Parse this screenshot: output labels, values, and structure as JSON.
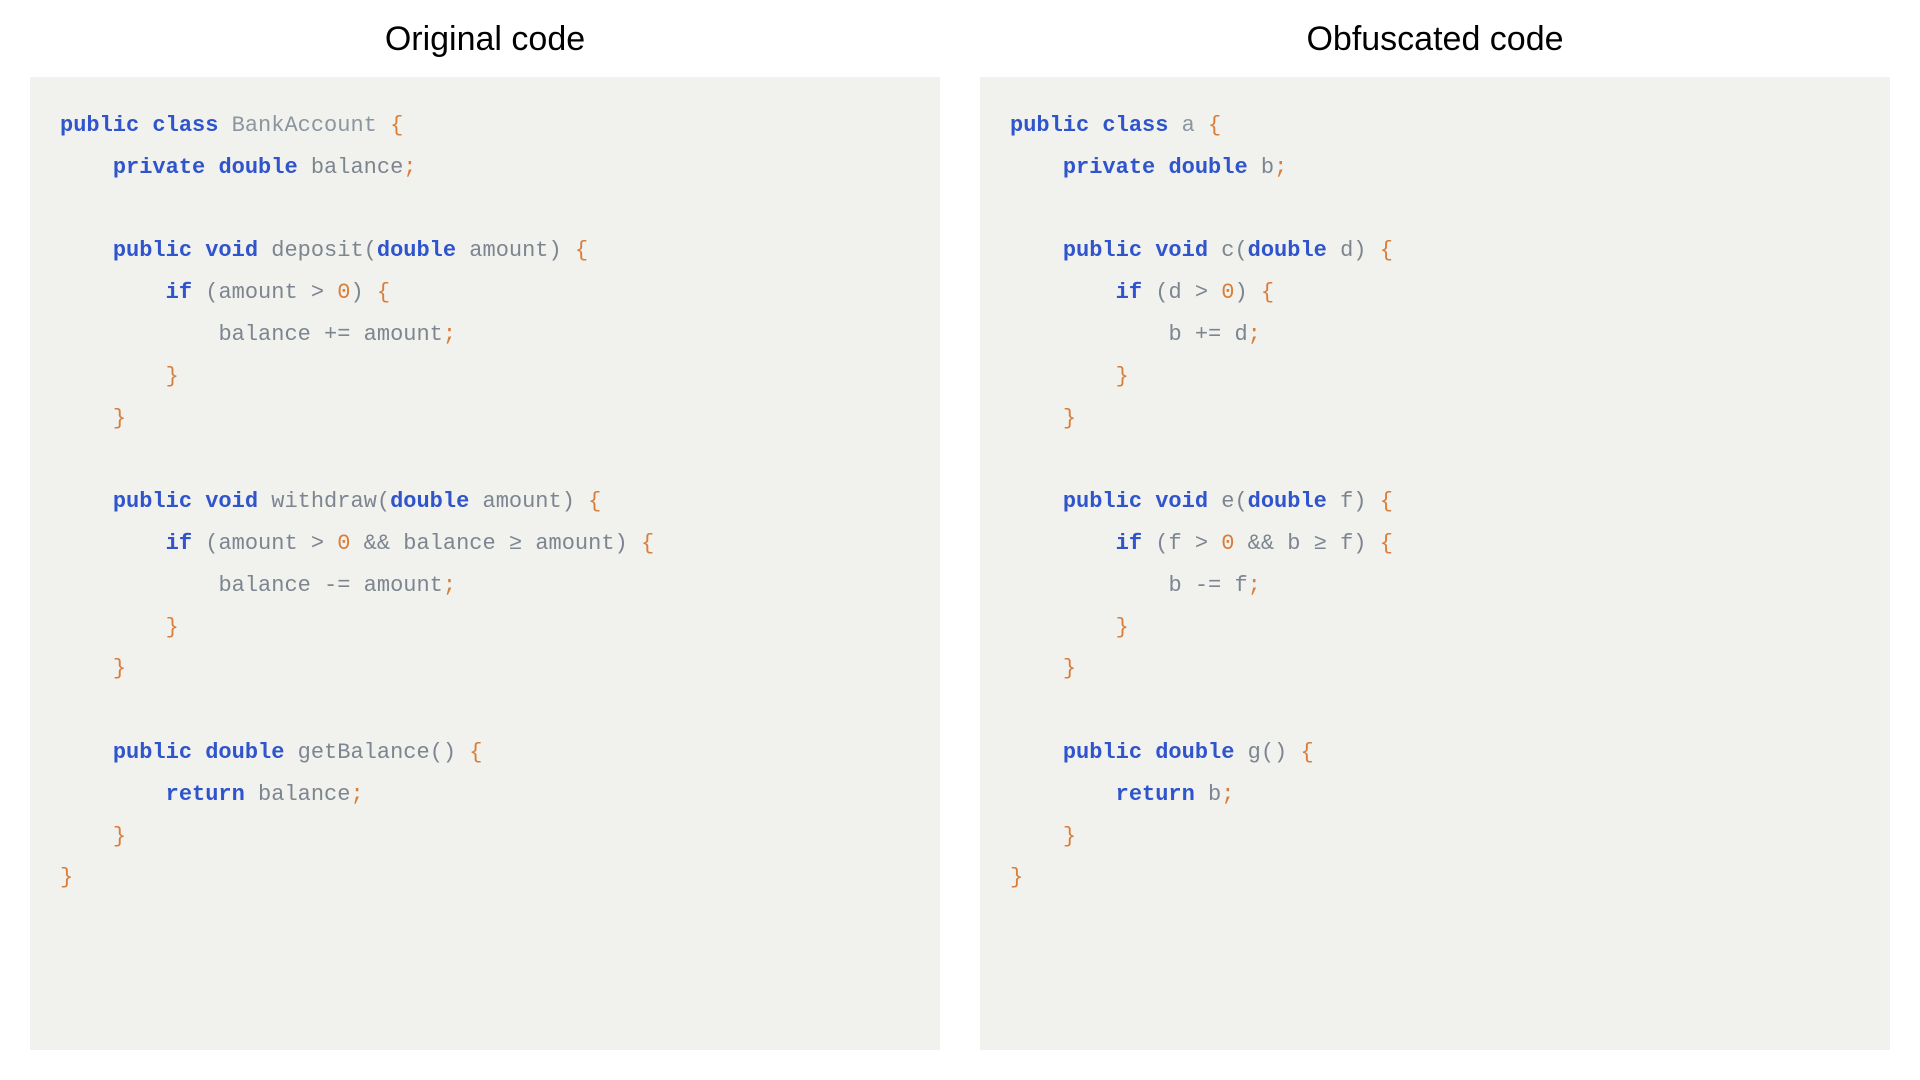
{
  "left": {
    "title": "Original code",
    "code": [
      [
        {
          "t": "public",
          "c": "kw"
        },
        {
          "t": " ",
          "c": ""
        },
        {
          "t": "class",
          "c": "kw"
        },
        {
          "t": " ",
          "c": ""
        },
        {
          "t": "BankAccount",
          "c": "cls"
        },
        {
          "t": " ",
          "c": ""
        },
        {
          "t": "{",
          "c": "pun"
        }
      ],
      [
        {
          "t": "    ",
          "c": ""
        },
        {
          "t": "private",
          "c": "kw"
        },
        {
          "t": " ",
          "c": ""
        },
        {
          "t": "double",
          "c": "typ"
        },
        {
          "t": " ",
          "c": ""
        },
        {
          "t": "balance",
          "c": "id"
        },
        {
          "t": ";",
          "c": "pun"
        }
      ],
      [],
      [
        {
          "t": "    ",
          "c": ""
        },
        {
          "t": "public",
          "c": "kw"
        },
        {
          "t": " ",
          "c": ""
        },
        {
          "t": "void",
          "c": "kw"
        },
        {
          "t": " ",
          "c": ""
        },
        {
          "t": "deposit",
          "c": "fn"
        },
        {
          "t": "(",
          "c": "op"
        },
        {
          "t": "double",
          "c": "typ"
        },
        {
          "t": " ",
          "c": ""
        },
        {
          "t": "amount",
          "c": "id"
        },
        {
          "t": ")",
          "c": "op"
        },
        {
          "t": " ",
          "c": ""
        },
        {
          "t": "{",
          "c": "pun"
        }
      ],
      [
        {
          "t": "        ",
          "c": ""
        },
        {
          "t": "if",
          "c": "kw"
        },
        {
          "t": " ",
          "c": ""
        },
        {
          "t": "(",
          "c": "op"
        },
        {
          "t": "amount",
          "c": "id"
        },
        {
          "t": " > ",
          "c": "op"
        },
        {
          "t": "0",
          "c": "num"
        },
        {
          "t": ")",
          "c": "op"
        },
        {
          "t": " ",
          "c": ""
        },
        {
          "t": "{",
          "c": "pun"
        }
      ],
      [
        {
          "t": "            ",
          "c": ""
        },
        {
          "t": "balance",
          "c": "id"
        },
        {
          "t": " += ",
          "c": "op"
        },
        {
          "t": "amount",
          "c": "id"
        },
        {
          "t": ";",
          "c": "pun"
        }
      ],
      [
        {
          "t": "        ",
          "c": ""
        },
        {
          "t": "}",
          "c": "pun"
        }
      ],
      [
        {
          "t": "    ",
          "c": ""
        },
        {
          "t": "}",
          "c": "pun"
        }
      ],
      [],
      [
        {
          "t": "    ",
          "c": ""
        },
        {
          "t": "public",
          "c": "kw"
        },
        {
          "t": " ",
          "c": ""
        },
        {
          "t": "void",
          "c": "kw"
        },
        {
          "t": " ",
          "c": ""
        },
        {
          "t": "withdraw",
          "c": "fn"
        },
        {
          "t": "(",
          "c": "op"
        },
        {
          "t": "double",
          "c": "typ"
        },
        {
          "t": " ",
          "c": ""
        },
        {
          "t": "amount",
          "c": "id"
        },
        {
          "t": ")",
          "c": "op"
        },
        {
          "t": " ",
          "c": ""
        },
        {
          "t": "{",
          "c": "pun"
        }
      ],
      [
        {
          "t": "        ",
          "c": ""
        },
        {
          "t": "if",
          "c": "kw"
        },
        {
          "t": " ",
          "c": ""
        },
        {
          "t": "(",
          "c": "op"
        },
        {
          "t": "amount",
          "c": "id"
        },
        {
          "t": " > ",
          "c": "op"
        },
        {
          "t": "0",
          "c": "num"
        },
        {
          "t": " && ",
          "c": "op"
        },
        {
          "t": "balance",
          "c": "id"
        },
        {
          "t": " ≥ ",
          "c": "op"
        },
        {
          "t": "amount",
          "c": "id"
        },
        {
          "t": ")",
          "c": "op"
        },
        {
          "t": " ",
          "c": ""
        },
        {
          "t": "{",
          "c": "pun"
        }
      ],
      [
        {
          "t": "            ",
          "c": ""
        },
        {
          "t": "balance",
          "c": "id"
        },
        {
          "t": " -= ",
          "c": "op"
        },
        {
          "t": "amount",
          "c": "id"
        },
        {
          "t": ";",
          "c": "pun"
        }
      ],
      [
        {
          "t": "        ",
          "c": ""
        },
        {
          "t": "}",
          "c": "pun"
        }
      ],
      [
        {
          "t": "    ",
          "c": ""
        },
        {
          "t": "}",
          "c": "pun"
        }
      ],
      [],
      [
        {
          "t": "    ",
          "c": ""
        },
        {
          "t": "public",
          "c": "kw"
        },
        {
          "t": " ",
          "c": ""
        },
        {
          "t": "double",
          "c": "typ"
        },
        {
          "t": " ",
          "c": ""
        },
        {
          "t": "getBalance",
          "c": "fn"
        },
        {
          "t": "()",
          "c": "op"
        },
        {
          "t": " ",
          "c": ""
        },
        {
          "t": "{",
          "c": "pun"
        }
      ],
      [
        {
          "t": "        ",
          "c": ""
        },
        {
          "t": "return",
          "c": "kw"
        },
        {
          "t": " ",
          "c": ""
        },
        {
          "t": "balance",
          "c": "id"
        },
        {
          "t": ";",
          "c": "pun"
        }
      ],
      [
        {
          "t": "    ",
          "c": ""
        },
        {
          "t": "}",
          "c": "pun"
        }
      ],
      [
        {
          "t": "}",
          "c": "pun"
        }
      ]
    ]
  },
  "right": {
    "title": "Obfuscated code",
    "code": [
      [
        {
          "t": "public",
          "c": "kw"
        },
        {
          "t": " ",
          "c": ""
        },
        {
          "t": "class",
          "c": "kw"
        },
        {
          "t": " ",
          "c": ""
        },
        {
          "t": "a",
          "c": "cls"
        },
        {
          "t": " ",
          "c": ""
        },
        {
          "t": "{",
          "c": "pun"
        }
      ],
      [
        {
          "t": "    ",
          "c": ""
        },
        {
          "t": "private",
          "c": "kw"
        },
        {
          "t": " ",
          "c": ""
        },
        {
          "t": "double",
          "c": "typ"
        },
        {
          "t": " ",
          "c": ""
        },
        {
          "t": "b",
          "c": "id"
        },
        {
          "t": ";",
          "c": "pun"
        }
      ],
      [],
      [
        {
          "t": "    ",
          "c": ""
        },
        {
          "t": "public",
          "c": "kw"
        },
        {
          "t": " ",
          "c": ""
        },
        {
          "t": "void",
          "c": "kw"
        },
        {
          "t": " ",
          "c": ""
        },
        {
          "t": "c",
          "c": "fn"
        },
        {
          "t": "(",
          "c": "op"
        },
        {
          "t": "double",
          "c": "typ"
        },
        {
          "t": " ",
          "c": ""
        },
        {
          "t": "d",
          "c": "id"
        },
        {
          "t": ")",
          "c": "op"
        },
        {
          "t": " ",
          "c": ""
        },
        {
          "t": "{",
          "c": "pun"
        }
      ],
      [
        {
          "t": "        ",
          "c": ""
        },
        {
          "t": "if",
          "c": "kw"
        },
        {
          "t": " ",
          "c": ""
        },
        {
          "t": "(",
          "c": "op"
        },
        {
          "t": "d",
          "c": "id"
        },
        {
          "t": " > ",
          "c": "op"
        },
        {
          "t": "0",
          "c": "num"
        },
        {
          "t": ")",
          "c": "op"
        },
        {
          "t": " ",
          "c": ""
        },
        {
          "t": "{",
          "c": "pun"
        }
      ],
      [
        {
          "t": "            ",
          "c": ""
        },
        {
          "t": "b",
          "c": "id"
        },
        {
          "t": " += ",
          "c": "op"
        },
        {
          "t": "d",
          "c": "id"
        },
        {
          "t": ";",
          "c": "pun"
        }
      ],
      [
        {
          "t": "        ",
          "c": ""
        },
        {
          "t": "}",
          "c": "pun"
        }
      ],
      [
        {
          "t": "    ",
          "c": ""
        },
        {
          "t": "}",
          "c": "pun"
        }
      ],
      [],
      [
        {
          "t": "    ",
          "c": ""
        },
        {
          "t": "public",
          "c": "kw"
        },
        {
          "t": " ",
          "c": ""
        },
        {
          "t": "void",
          "c": "kw"
        },
        {
          "t": " ",
          "c": ""
        },
        {
          "t": "e",
          "c": "fn"
        },
        {
          "t": "(",
          "c": "op"
        },
        {
          "t": "double",
          "c": "typ"
        },
        {
          "t": " ",
          "c": ""
        },
        {
          "t": "f",
          "c": "id"
        },
        {
          "t": ")",
          "c": "op"
        },
        {
          "t": " ",
          "c": ""
        },
        {
          "t": "{",
          "c": "pun"
        }
      ],
      [
        {
          "t": "        ",
          "c": ""
        },
        {
          "t": "if",
          "c": "kw"
        },
        {
          "t": " ",
          "c": ""
        },
        {
          "t": "(",
          "c": "op"
        },
        {
          "t": "f",
          "c": "id"
        },
        {
          "t": " > ",
          "c": "op"
        },
        {
          "t": "0",
          "c": "num"
        },
        {
          "t": " && ",
          "c": "op"
        },
        {
          "t": "b",
          "c": "id"
        },
        {
          "t": " ≥ ",
          "c": "op"
        },
        {
          "t": "f",
          "c": "id"
        },
        {
          "t": ")",
          "c": "op"
        },
        {
          "t": " ",
          "c": ""
        },
        {
          "t": "{",
          "c": "pun"
        }
      ],
      [
        {
          "t": "            ",
          "c": ""
        },
        {
          "t": "b",
          "c": "id"
        },
        {
          "t": " -= ",
          "c": "op"
        },
        {
          "t": "f",
          "c": "id"
        },
        {
          "t": ";",
          "c": "pun"
        }
      ],
      [
        {
          "t": "        ",
          "c": ""
        },
        {
          "t": "}",
          "c": "pun"
        }
      ],
      [
        {
          "t": "    ",
          "c": ""
        },
        {
          "t": "}",
          "c": "pun"
        }
      ],
      [],
      [
        {
          "t": "    ",
          "c": ""
        },
        {
          "t": "public",
          "c": "kw"
        },
        {
          "t": " ",
          "c": ""
        },
        {
          "t": "double",
          "c": "typ"
        },
        {
          "t": " ",
          "c": ""
        },
        {
          "t": "g",
          "c": "fn"
        },
        {
          "t": "()",
          "c": "op"
        },
        {
          "t": " ",
          "c": ""
        },
        {
          "t": "{",
          "c": "pun"
        }
      ],
      [
        {
          "t": "        ",
          "c": ""
        },
        {
          "t": "return",
          "c": "kw"
        },
        {
          "t": " ",
          "c": ""
        },
        {
          "t": "b",
          "c": "id"
        },
        {
          "t": ";",
          "c": "pun"
        }
      ],
      [
        {
          "t": "    ",
          "c": ""
        },
        {
          "t": "}",
          "c": "pun"
        }
      ],
      [
        {
          "t": "}",
          "c": "pun"
        }
      ]
    ]
  }
}
